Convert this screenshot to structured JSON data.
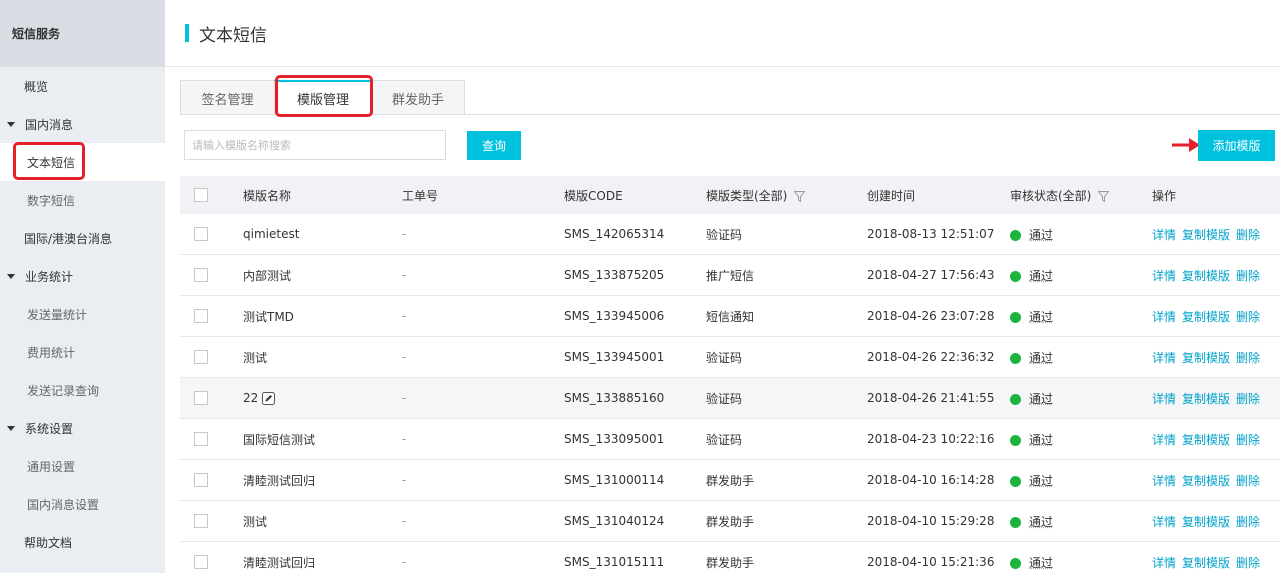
{
  "sidebar": {
    "header": "短信服务",
    "items": {
      "overview": "概览",
      "domestic": "国内消息",
      "text_sms": "文本短信",
      "digital_sms": "数字短信",
      "international": "国际/港澳台消息",
      "stats": "业务统计",
      "send_stats": "发送量统计",
      "cost_stats": "费用统计",
      "send_records": "发送记录查询",
      "settings": "系统设置",
      "general_settings": "通用设置",
      "domestic_settings": "国内消息设置",
      "help": "帮助文档"
    }
  },
  "page": {
    "title": "文本短信"
  },
  "tabs": {
    "signature": "签名管理",
    "template": "模版管理",
    "bulk": "群发助手"
  },
  "search": {
    "placeholder": "请输入模版名称搜索",
    "query_button": "查询",
    "add_button": "添加模版"
  },
  "table": {
    "headers": {
      "name": "模版名称",
      "ticket": "工单号",
      "code": "模版CODE",
      "type": "模版类型(全部)",
      "created": "创建时间",
      "status": "审核状态(全部)",
      "actions": "操作"
    },
    "rows": [
      {
        "name": "qimietest",
        "ticket": "-",
        "code": "SMS_142065314",
        "type": "验证码",
        "created": "2018-08-13 12:51:07",
        "status": "通过"
      },
      {
        "name": "内部测试",
        "ticket": "-",
        "code": "SMS_133875205",
        "type": "推广短信",
        "created": "2018-04-27 17:56:43",
        "status": "通过"
      },
      {
        "name": "测试TMD",
        "ticket": "-",
        "code": "SMS_133945006",
        "type": "短信通知",
        "created": "2018-04-26 23:07:28",
        "status": "通过"
      },
      {
        "name": "测试",
        "ticket": "-",
        "code": "SMS_133945001",
        "type": "验证码",
        "created": "2018-04-26 22:36:32",
        "status": "通过"
      },
      {
        "name": "22",
        "ticket": "-",
        "code": "SMS_133885160",
        "type": "验证码",
        "created": "2018-04-26 21:41:55",
        "status": "通过"
      },
      {
        "name": "国际短信测试",
        "ticket": "-",
        "code": "SMS_133095001",
        "type": "验证码",
        "created": "2018-04-23 10:22:16",
        "status": "通过"
      },
      {
        "name": "清睦测试回归",
        "ticket": "-",
        "code": "SMS_131000114",
        "type": "群发助手",
        "created": "2018-04-10 16:14:28",
        "status": "通过"
      },
      {
        "name": "测试",
        "ticket": "-",
        "code": "SMS_131040124",
        "type": "群发助手",
        "created": "2018-04-10 15:29:28",
        "status": "通过"
      },
      {
        "name": "清睦测试回归",
        "ticket": "-",
        "code": "SMS_131015111",
        "type": "群发助手",
        "created": "2018-04-10 15:21:36",
        "status": "通过"
      }
    ],
    "actions": {
      "details": "详情",
      "copy": "复制模版",
      "delete": "删除"
    }
  },
  "colors": {
    "accent": "#00c1de",
    "link": "#00a2ca",
    "status_ok": "#1cb43f",
    "highlight": "#e4202a"
  }
}
